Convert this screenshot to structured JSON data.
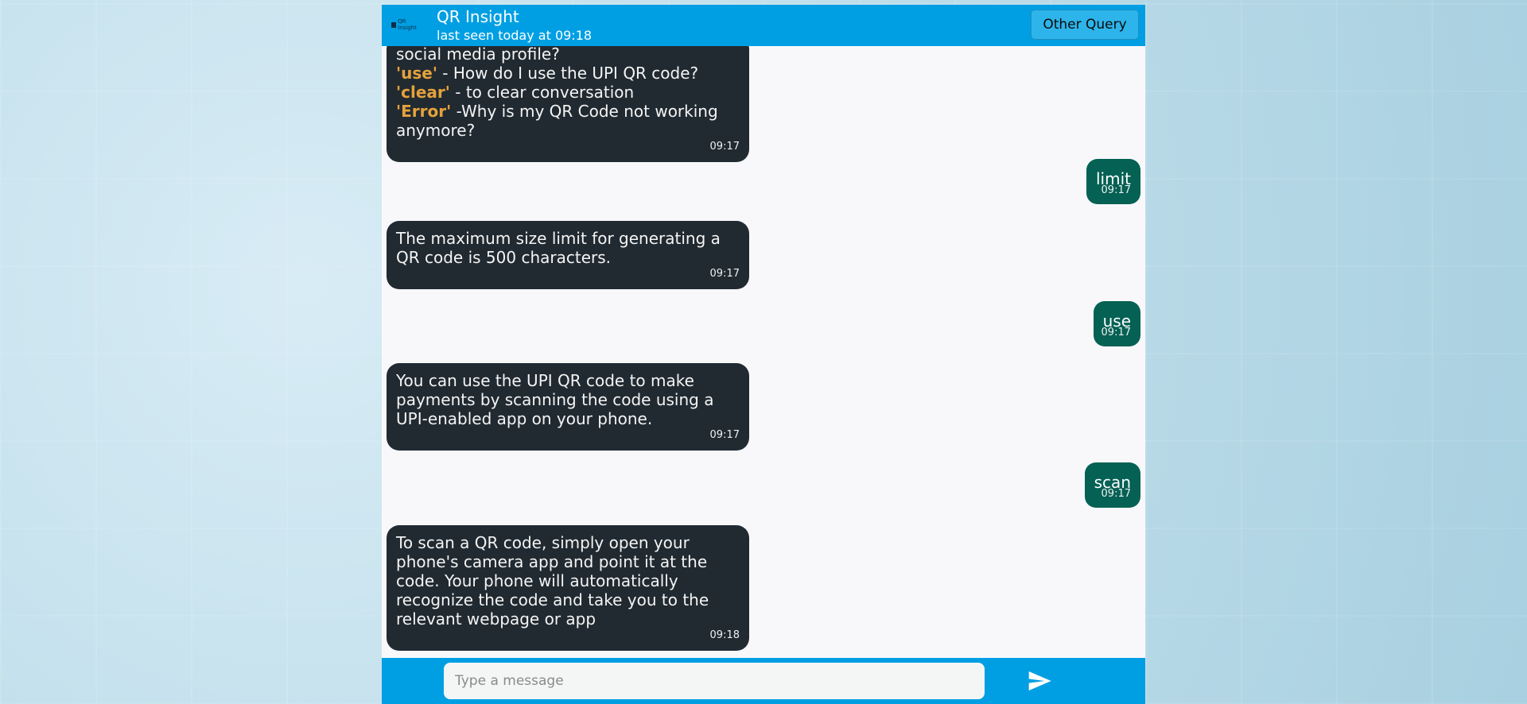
{
  "header": {
    "logo_text": "QR Insight",
    "title": "QR Insight",
    "status": "last seen today at 09:18",
    "other_button": "Other Query"
  },
  "messages": [
    {
      "from": "bot",
      "partial_top": "social media profile?",
      "lines": [
        {
          "keyword": "'use'",
          "text": " - How do I use the UPI QR code?"
        },
        {
          "keyword": "'clear'",
          "text": " - to clear conversation"
        },
        {
          "keyword": "'Error'",
          "text": " -Why is my QR Code not working anymore?"
        }
      ],
      "time": "09:17"
    },
    {
      "from": "user",
      "text": "limit",
      "time": "09:17"
    },
    {
      "from": "bot",
      "text": "The maximum size limit for generating a QR code is 500 characters.",
      "time": "09:17"
    },
    {
      "from": "user",
      "text": "use",
      "time": "09:17"
    },
    {
      "from": "bot",
      "text": "You can use the UPI QR code to make payments by scanning the code using a UPI-enabled app on your phone.",
      "time": "09:17"
    },
    {
      "from": "user",
      "text": "scan",
      "time": "09:17"
    },
    {
      "from": "bot",
      "text": "To scan a QR code, simply open your phone's camera app and point it at the code. Your phone will automatically recognize the code and take you to the relevant webpage or app",
      "time": "09:18"
    }
  ],
  "composer": {
    "placeholder": "Type a message",
    "value": ""
  },
  "icons": {
    "send": "send-icon",
    "logo": "qr-insight-logo"
  },
  "colors": {
    "header": "#009fe3",
    "bot_bubble": "#212a31",
    "user_bubble": "#046154",
    "keyword": "#e5a13c"
  }
}
